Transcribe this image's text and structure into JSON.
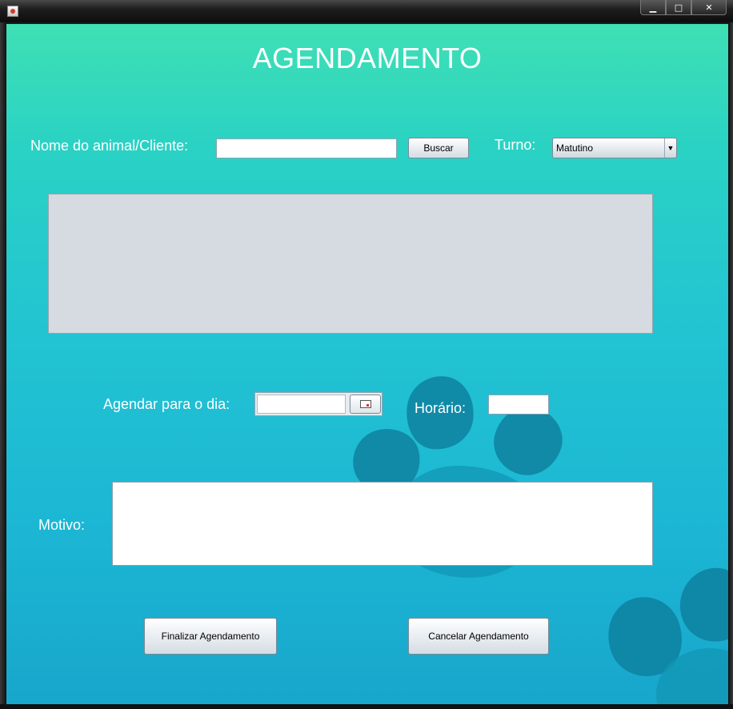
{
  "window": {
    "title": "",
    "minimize_glyph": "▁",
    "maximize_glyph": "□",
    "close_glyph": "✕"
  },
  "form": {
    "title": "AGENDAMENTO",
    "search": {
      "label": "Nome do animal/Cliente:",
      "value": "",
      "button_label": "Buscar"
    },
    "turno": {
      "label": "Turno:",
      "selected": "Matutino",
      "arrow": "▼"
    },
    "date": {
      "label": "Agendar para o dia:",
      "value": ""
    },
    "horario": {
      "label": "Horário:",
      "value": ""
    },
    "motivo": {
      "label": "Motivo:",
      "value": ""
    },
    "buttons": {
      "finalize": "Finalizar Agendamento",
      "cancel": "Cancelar Agendamento"
    }
  },
  "colors": {
    "background_top": "#3fe0b4",
    "background_bottom": "#18a6cc",
    "paw": "#0e7f9e",
    "results_panel": "#d6dae1"
  },
  "icons": [
    "java-app-icon",
    "calendar-icon",
    "paw-print-decoration"
  ]
}
